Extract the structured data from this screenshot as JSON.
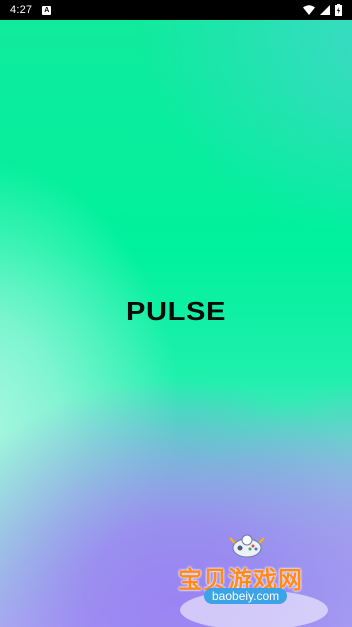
{
  "status_bar": {
    "time": "4:27",
    "notification_badge": "A",
    "icons": [
      "wifi-icon",
      "signal-icon",
      "battery-icon"
    ]
  },
  "splash": {
    "logo_text": "PULSE"
  },
  "watermark": {
    "site_name": "宝贝游戏网",
    "site_url": "baobeiy.com",
    "icon": "gamepad-icon"
  },
  "colors": {
    "primary_green": "#00f19d",
    "purple": "#9a84f2",
    "logo_text": "#0b0b0b",
    "watermark_orange": "#ff8a1d",
    "watermark_blue": "#3ba3e6"
  }
}
